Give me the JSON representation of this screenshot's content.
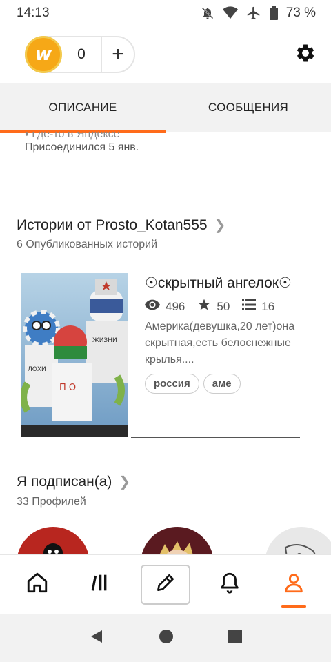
{
  "status_bar": {
    "time": "14:13",
    "battery": "73 %",
    "icons": [
      "bell-off-icon",
      "wifi-icon",
      "airplane-icon",
      "battery-icon"
    ]
  },
  "header": {
    "coin_count": "0",
    "plus_label": "+",
    "settings_icon": "gear-icon"
  },
  "tabs": [
    {
      "label": "ОПИСАНИЕ",
      "active": true
    },
    {
      "label": "СООБЩЕНИЯ",
      "active": false
    }
  ],
  "profile": {
    "cut_line": "Где-то в Яндексе",
    "joined": "Присоединился 5 янв."
  },
  "stories": {
    "title": "Истории от Prosto_Kotan555",
    "subtitle": "6 Опубликованных историй",
    "items": [
      {
        "title": "☉скрытный ангелок☉",
        "reads": "496",
        "votes": "50",
        "parts": "16",
        "description": "Америка(девушка,20 лет)она скрытная,есть белоснежные крылья....",
        "tags": [
          "россия",
          "аме"
        ]
      }
    ]
  },
  "following": {
    "title": "Я подписан(а)",
    "subtitle": "33 Профилей"
  },
  "bottom_nav": [
    {
      "name": "home",
      "icon": "home-icon"
    },
    {
      "name": "library",
      "icon": "library-icon"
    },
    {
      "name": "write",
      "icon": "pencil-icon"
    },
    {
      "name": "notifications",
      "icon": "bell-icon"
    },
    {
      "name": "profile",
      "icon": "user-icon",
      "active": true
    }
  ],
  "colors": {
    "accent": "#ff6b1a",
    "coin": "#f6a817"
  }
}
